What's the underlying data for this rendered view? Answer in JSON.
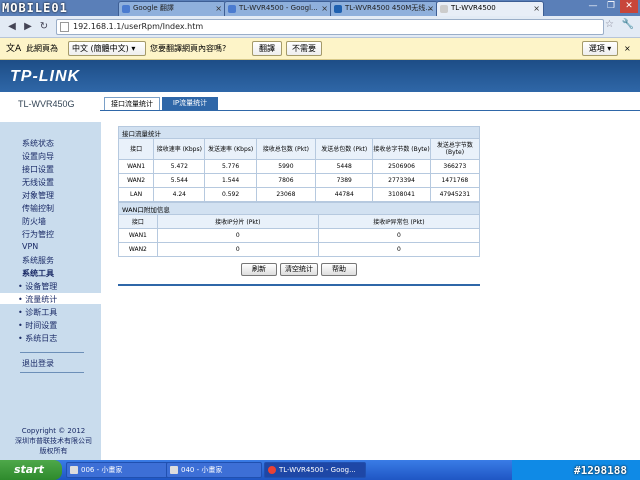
{
  "watermark": "MOBILE01",
  "watermark_id": "#1298188",
  "browser": {
    "tabs": [
      {
        "label": "Google 翻譯",
        "color": "#4a7bd0"
      },
      {
        "label": "TL-WVR4500 - Googl...",
        "color": "#4a7bd0"
      },
      {
        "label": "TL-WVR4500 450M无线...",
        "color": "#1e60b0"
      },
      {
        "label": "TL-WVR4500",
        "color": "#cccccc"
      }
    ],
    "url": "192.168.1.1/userRpm/Index.htm",
    "translate_bar": {
      "prefix": "此網頁為",
      "language": "中文 (簡體中文)",
      "question": "您要翻譯網頁內容嗎?",
      "translate": "翻譯",
      "decline": "不需要",
      "options": "選項"
    }
  },
  "page": {
    "brand": "TP-LINK",
    "model": "TL-WVR450G",
    "tabs": [
      "接口流量统计",
      "IP流量统计"
    ],
    "sidebar": {
      "items": [
        {
          "label": "系统状态"
        },
        {
          "label": "设置向导"
        },
        {
          "label": "接口设置"
        },
        {
          "label": "无线设置"
        },
        {
          "label": "对象管理"
        },
        {
          "label": "传输控制"
        },
        {
          "label": "防火墙"
        },
        {
          "label": "行为管控"
        },
        {
          "label": "VPN"
        },
        {
          "label": "系统服务"
        },
        {
          "label": "系统工具"
        },
        {
          "label": "• 设备管理"
        },
        {
          "label": "• 流量统计"
        },
        {
          "label": "• 诊断工具"
        },
        {
          "label": "• 时间设置"
        },
        {
          "label": "• 系统日志"
        },
        {
          "label": "退出登录"
        }
      ],
      "copyright": [
        "Copyright © 2012",
        "深圳市普联技术有限公司",
        "版权所有"
      ]
    },
    "stats": {
      "title": "接口流量统计",
      "headers": [
        "接口",
        "接收速率 (Kbps)",
        "发送速率 (Kbps)",
        "接收总包数 (Pkt)",
        "发送总包数 (Pkt)",
        "接收总字节数 (Byte)",
        "发送总字节数 (Byte)"
      ],
      "rows": [
        [
          "WAN1",
          "5.472",
          "5.776",
          "5990",
          "5448",
          "2506906",
          "366273"
        ],
        [
          "WAN2",
          "5.544",
          "1.544",
          "7806",
          "7389",
          "2773394",
          "1471768"
        ],
        [
          "LAN",
          "4.24",
          "0.592",
          "23068",
          "44784",
          "3108041",
          "47945231"
        ]
      ]
    },
    "wan_extra": {
      "title": "WAN口附加信息",
      "headers": [
        "接口",
        "接收IP分片 (Pkt)",
        "接收IP异常包 (Pkt)"
      ],
      "rows": [
        [
          "WAN1",
          "0",
          "0"
        ],
        [
          "WAN2",
          "0",
          "0"
        ]
      ]
    },
    "buttons": [
      "刷新",
      "清空统计",
      "帮助"
    ]
  },
  "taskbar": {
    "start": "start",
    "tasks": [
      "006 - 小畫家",
      "040 - 小畫家",
      "TL-WVR4500 - Goog..."
    ]
  }
}
